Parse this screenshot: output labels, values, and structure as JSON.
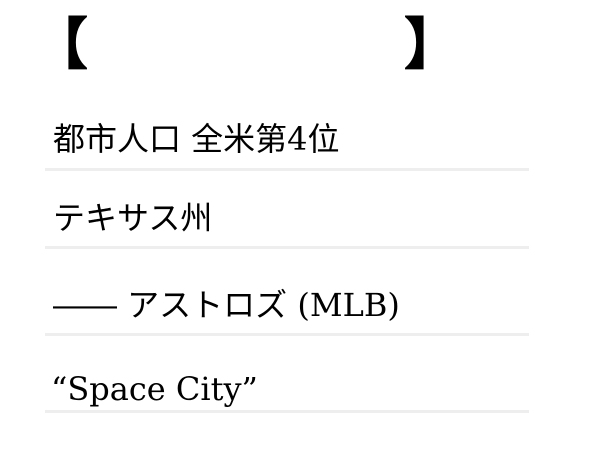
{
  "answer_frame": {
    "open_bracket": "【",
    "close_bracket": "】",
    "answer": ""
  },
  "hints": [
    "都市人口 全米第4位",
    "テキサス州",
    "―― アストロズ (MLB)",
    "“Space City”"
  ]
}
